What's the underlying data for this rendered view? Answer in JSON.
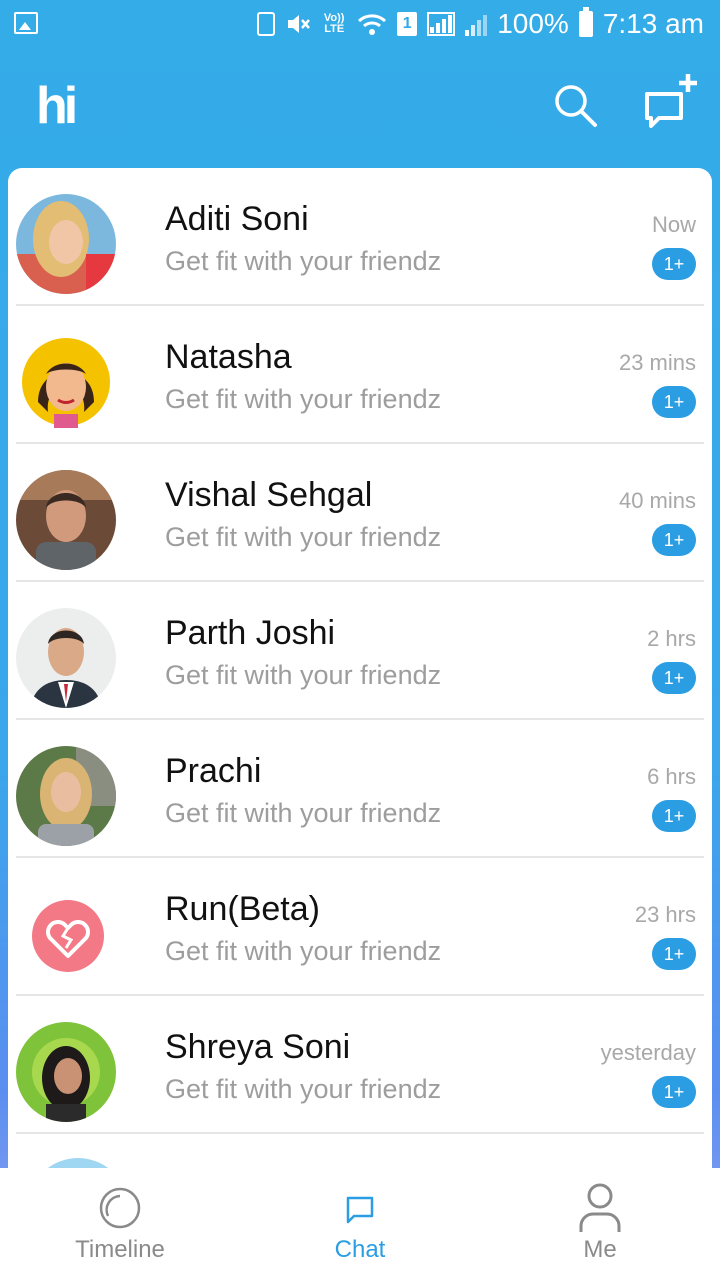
{
  "status_bar": {
    "battery": "100%",
    "time": "7:13 am",
    "sim_badge": "1",
    "lte_label": "Vo)) LTE"
  },
  "app_bar": {
    "logo_text": "hi",
    "search_icon": "search-icon",
    "compose_icon": "new-chat-icon"
  },
  "chats": [
    {
      "name": "Aditi Soni",
      "message": "Get fit with your friendz",
      "time": "Now",
      "badge": "1+"
    },
    {
      "name": "Natasha",
      "message": "Get fit with your friendz",
      "time": "23 mins",
      "badge": "1+"
    },
    {
      "name": "Vishal Sehgal",
      "message": "Get fit with your friendz",
      "time": "40 mins",
      "badge": "1+"
    },
    {
      "name": "Parth Joshi",
      "message": "Get fit with your friendz",
      "time": "2 hrs",
      "badge": "1+"
    },
    {
      "name": "Prachi",
      "message": "Get fit with your friendz",
      "time": "6 hrs",
      "badge": "1+"
    },
    {
      "name": "Run(Beta)",
      "message": "Get fit with your friendz",
      "time": "23 hrs",
      "badge": "1+"
    },
    {
      "name": "Shreya Soni",
      "message": "Get fit with your friendz",
      "time": "yesterday",
      "badge": "1+"
    }
  ],
  "bottom_nav": {
    "timeline": "Timeline",
    "chat": "Chat",
    "me": "Me",
    "active": "Chat"
  },
  "colors": {
    "accent": "#2a9de3",
    "header": "#35abe8"
  }
}
